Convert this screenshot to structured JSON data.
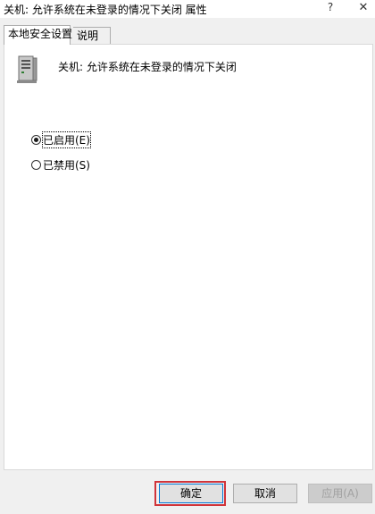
{
  "window": {
    "title": "关机: 允许系统在未登录的情况下关闭 属性",
    "help_label": "?",
    "close_label": "✕"
  },
  "tabs": [
    {
      "label": "本地安全设置",
      "active": true
    },
    {
      "label": "说明",
      "active": false
    }
  ],
  "policy": {
    "icon": "server-icon",
    "name": "关机: 允许系统在未登录的情况下关闭"
  },
  "options": [
    {
      "label": "已启用(E)",
      "checked": true
    },
    {
      "label": "已禁用(S)",
      "checked": false
    }
  ],
  "buttons": {
    "ok": "确定",
    "cancel": "取消",
    "apply": "应用(A)"
  },
  "colors": {
    "highlight": "#d0343a",
    "focus_border": "#0078d7"
  }
}
